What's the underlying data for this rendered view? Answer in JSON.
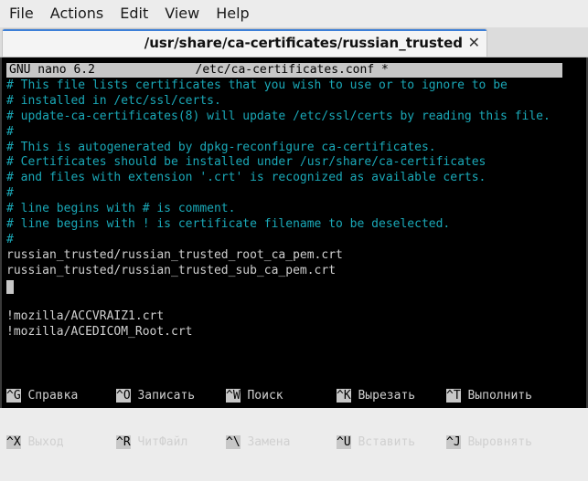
{
  "menubar": {
    "items": [
      "File",
      "Actions",
      "Edit",
      "View",
      "Help"
    ]
  },
  "tab": {
    "title": "/usr/share/ca-certificates/russian_trusted",
    "close": "✕"
  },
  "nano": {
    "header": "GNU nano 6.2              /etc/ca-certificates.conf *"
  },
  "file_lines": [
    {
      "text": "# This file lists certificates that you wish to use or to ignore to be",
      "kind": "comment"
    },
    {
      "text": "# installed in /etc/ssl/certs.",
      "kind": "comment"
    },
    {
      "text": "# update-ca-certificates(8) will update /etc/ssl/certs by reading this file.",
      "kind": "comment"
    },
    {
      "text": "#",
      "kind": "comment"
    },
    {
      "text": "# This is autogenerated by dpkg-reconfigure ca-certificates.",
      "kind": "comment"
    },
    {
      "text": "# Certificates should be installed under /usr/share/ca-certificates",
      "kind": "comment"
    },
    {
      "text": "# and files with extension '.crt' is recognized as available certs.",
      "kind": "comment"
    },
    {
      "text": "#",
      "kind": "comment"
    },
    {
      "text": "# line begins with # is comment.",
      "kind": "comment"
    },
    {
      "text": "# line begins with ! is certificate filename to be deselected.",
      "kind": "comment"
    },
    {
      "text": "#",
      "kind": "comment"
    },
    {
      "text": "russian_trusted/russian_trusted_root_ca_pem.crt",
      "kind": "normal"
    },
    {
      "text": "russian_trusted/russian_trusted_sub_ca_pem.crt",
      "kind": "normal"
    },
    {
      "text": "",
      "kind": "cursor"
    },
    {
      "text": "",
      "kind": "normal"
    },
    {
      "text": "!mozilla/ACCVRAIZ1.crt",
      "kind": "normal"
    },
    {
      "text": "!mozilla/ACEDICOM_Root.crt",
      "kind": "normal"
    }
  ],
  "shortcuts": {
    "row1": [
      {
        "key": "^G",
        "label": "Справка"
      },
      {
        "key": "^O",
        "label": "Записать"
      },
      {
        "key": "^W",
        "label": "Поиск"
      },
      {
        "key": "^K",
        "label": "Вырезать"
      },
      {
        "key": "^T",
        "label": "Выполнить"
      }
    ],
    "row2": [
      {
        "key": "^X",
        "label": "Выход"
      },
      {
        "key": "^R",
        "label": "ЧитФайл"
      },
      {
        "key": "^\\",
        "label": "Замена"
      },
      {
        "key": "^U",
        "label": "Вставить"
      },
      {
        "key": "^J",
        "label": "Выровнять"
      }
    ]
  },
  "colors": {
    "comment": "#1aa9b8",
    "text": "#d0d0d0",
    "header_bg": "#c7c7c7",
    "terminal_bg": "#000000",
    "tab_accent": "#3c7fd8"
  }
}
